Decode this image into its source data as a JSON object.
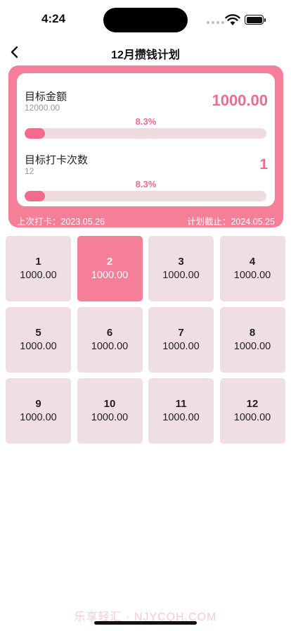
{
  "status": {
    "time": "4:24"
  },
  "nav": {
    "title": "12月攒钱计划"
  },
  "summary": {
    "amount_label": "目标金额",
    "amount_target": "12000.00",
    "amount_value": "1000.00",
    "amount_percent_text": "8.3%",
    "amount_progress": 0.083,
    "count_label": "目标打卡次数",
    "count_target": "12",
    "count_value": "1",
    "count_percent_text": "8.3%",
    "count_progress": 0.083,
    "last_checkin": "上次打卡：2023.05.26",
    "deadline": "计划截止：2024.05.25"
  },
  "months": [
    {
      "num": "1",
      "amount": "1000.00"
    },
    {
      "num": "2",
      "amount": "1000.00"
    },
    {
      "num": "3",
      "amount": "1000.00"
    },
    {
      "num": "4",
      "amount": "1000.00"
    },
    {
      "num": "5",
      "amount": "1000.00"
    },
    {
      "num": "6",
      "amount": "1000.00"
    },
    {
      "num": "7",
      "amount": "1000.00"
    },
    {
      "num": "8",
      "amount": "1000.00"
    },
    {
      "num": "9",
      "amount": "1000.00"
    },
    {
      "num": "10",
      "amount": "1000.00"
    },
    {
      "num": "11",
      "amount": "1000.00"
    },
    {
      "num": "12",
      "amount": "1000.00"
    }
  ],
  "active_month": "2",
  "watermark": "乐享轻汇 · NJYCQH.COM",
  "colors": {
    "accent": "#f06b8c",
    "card": "#f57e98",
    "cell": "#f0dfe2",
    "track": "#eedcdf"
  },
  "icons": {
    "back": "chevron-left-icon",
    "wifi": "wifi-icon",
    "battery": "battery-icon"
  }
}
